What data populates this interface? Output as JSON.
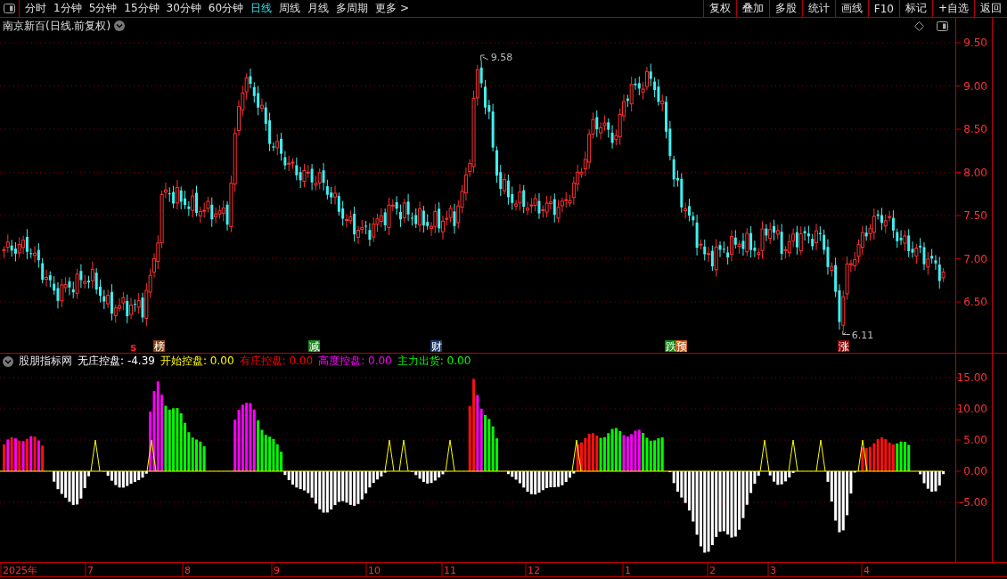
{
  "toolbar": {
    "periods": [
      {
        "label": "分时",
        "selected": false
      },
      {
        "label": "1分钟",
        "selected": false
      },
      {
        "label": "5分钟",
        "selected": false
      },
      {
        "label": "15分钟",
        "selected": false
      },
      {
        "label": "30分钟",
        "selected": false
      },
      {
        "label": "60分钟",
        "selected": false
      },
      {
        "label": "日线",
        "selected": true
      },
      {
        "label": "周线",
        "selected": false
      },
      {
        "label": "月线",
        "selected": false
      },
      {
        "label": "多周期",
        "selected": false
      },
      {
        "label": "更多 >",
        "selected": false
      }
    ],
    "buttons": [
      "复权",
      "叠加",
      "多股",
      "统计",
      "画线",
      "F10",
      "标记",
      "+自选",
      "返回"
    ]
  },
  "main_chart": {
    "title": "南京新百(日线.前复权)",
    "price_ticks": [
      "9.50",
      "9.00",
      "8.50",
      "8.00",
      "7.50",
      "7.00",
      "6.50"
    ],
    "high_label": "9.58",
    "low_label": "6.11",
    "signals": [
      {
        "text": "s",
        "color": "#ff2020"
      },
      {
        "text": "榜",
        "color": "#8b4513"
      },
      {
        "text": "减",
        "color": "#1e8a1e"
      },
      {
        "text": "财",
        "color": "#1a3a6a"
      },
      {
        "text": "跌",
        "color": "#0a8a0a"
      },
      {
        "text": "预",
        "color": "#d05a10"
      },
      {
        "text": "涨",
        "color": "#8a0a0a"
      }
    ]
  },
  "indicator": {
    "name": "股朋指标网",
    "legend": [
      {
        "label": "无庄控盘:",
        "value": "-4.39",
        "color": "#ffffff"
      },
      {
        "label": "开始控盘:",
        "value": "0.00",
        "color": "#ffff00"
      },
      {
        "label": "有庄控盘:",
        "value": "0.00",
        "color": "#ff0000"
      },
      {
        "label": "高度控盘:",
        "value": "0.00",
        "color": "#ff00ff"
      },
      {
        "label": "主力出货:",
        "value": "0.00",
        "color": "#00ff00"
      }
    ],
    "ticks": [
      "15.00",
      "10.00",
      "5.00",
      "0.00",
      "-5.00"
    ]
  },
  "date_axis": [
    "2025年",
    "7",
    "8",
    "9",
    "10",
    "11",
    "12",
    "1",
    "2",
    "3",
    "4"
  ]
}
